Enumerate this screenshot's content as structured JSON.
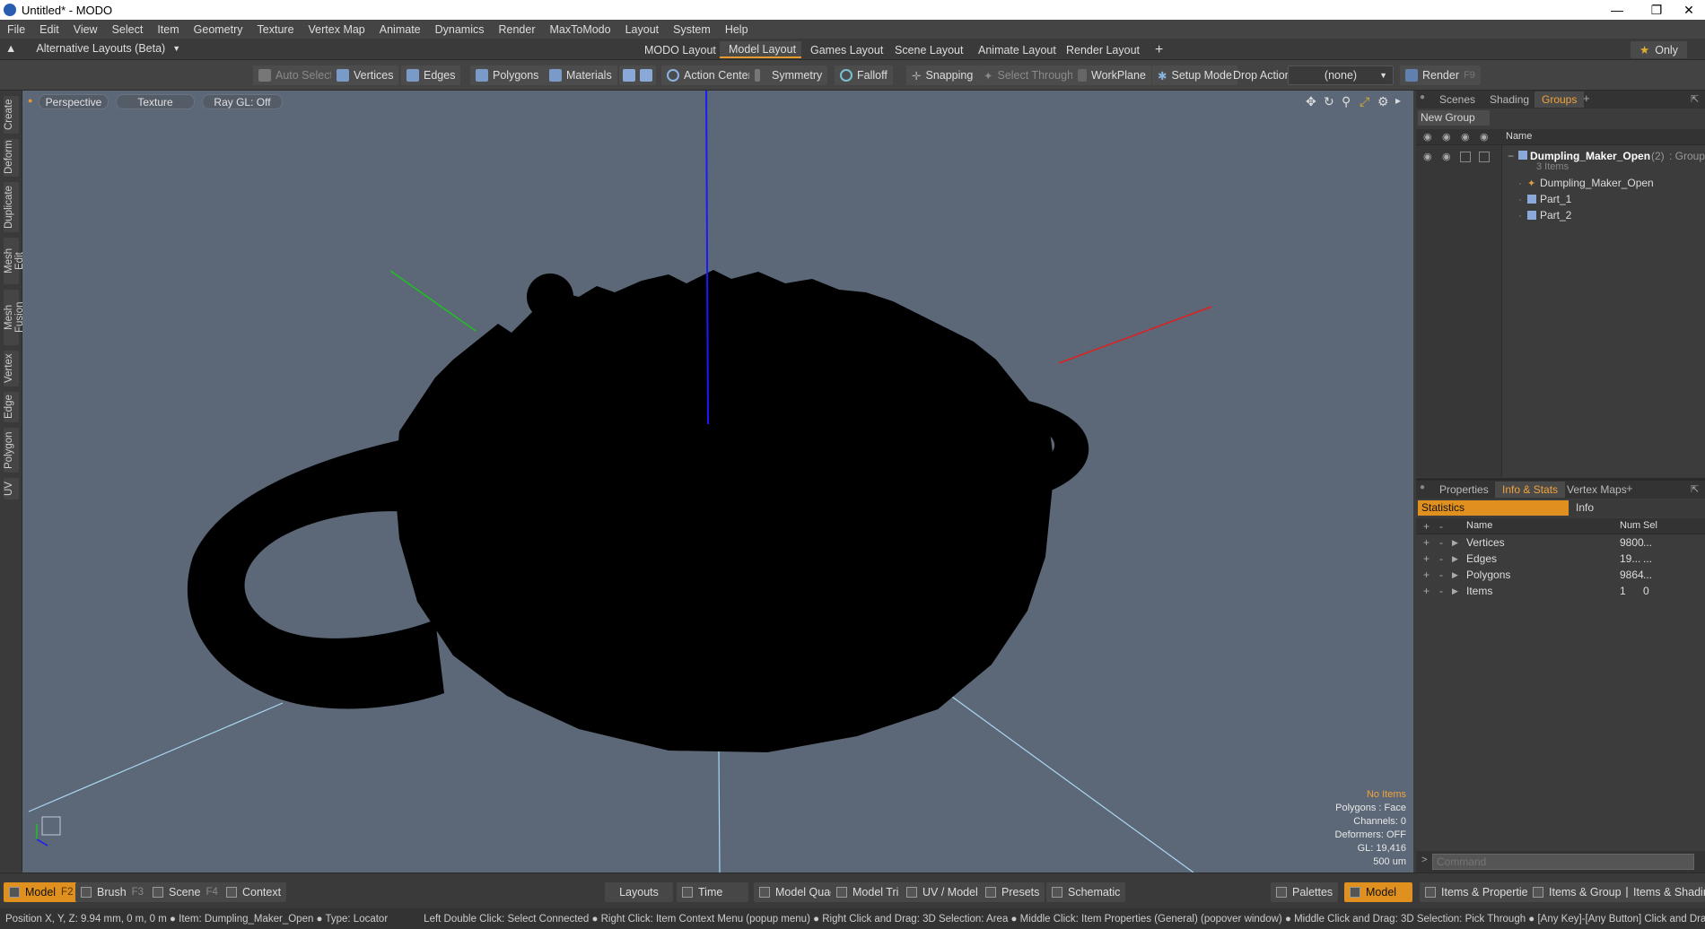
{
  "window": {
    "title": "Untitled* - MODO"
  },
  "menu": [
    "File",
    "Edit",
    "View",
    "Select",
    "Item",
    "Geometry",
    "Texture",
    "Vertex Map",
    "Animate",
    "Dynamics",
    "Render",
    "MaxToModo",
    "Layout",
    "System",
    "Help"
  ],
  "layoutbar": {
    "alt_layouts": "Alternative Layouts (Beta)",
    "tabs": [
      "MODO Layout",
      "Model Layout",
      "Games Layout",
      "Scene Layout",
      "Animate Layout",
      "Render Layout"
    ],
    "active_tab": "Model Layout",
    "only_label": "Only"
  },
  "toolbar": {
    "auto_select": "Auto Select",
    "vertices": "Vertices",
    "edges": "Edges",
    "polygons": "Polygons",
    "materials": "Materials",
    "action_center": "Action Center",
    "symmetry": "Symmetry",
    "falloff": "Falloff",
    "snapping": "Snapping",
    "select_through": "Select Through",
    "workplane": "WorkPlane",
    "setup_mode": "Setup Mode",
    "drop_action_label": "Drop Action",
    "drop_action_value": "(none)",
    "render": "Render",
    "render_key": "F9"
  },
  "lefttabs": [
    "Create",
    "Deform",
    "Duplicate",
    "Mesh Edit",
    "Mesh Fusion",
    "Vertex",
    "Edge",
    "Polygon",
    "UV"
  ],
  "viewport": {
    "view_mode": "Perspective",
    "shading": "Texture",
    "raygl": "Ray GL: Off",
    "hud": {
      "no_items": "No Items",
      "polygons": "Polygons : Face",
      "channels": "Channels: 0",
      "deformers": "Deformers: OFF",
      "gl": "GL: 19,416",
      "scale": "500 um"
    }
  },
  "rightpanel": {
    "top_tabs": [
      "Scenes",
      "Shading",
      "Groups"
    ],
    "active_top_tab": "Groups",
    "new_group": "New Group",
    "name_header": "Name",
    "group": {
      "name": "Dumpling_Maker_Open",
      "count": "(2)",
      "type": ": Group",
      "subtitle": "3 Items"
    },
    "children": [
      "Dumpling_Maker_Open",
      "Part_1",
      "Part_2"
    ],
    "bottom_tabs": [
      "Properties",
      "Info & Stats",
      "Vertex Maps"
    ],
    "active_bottom_tab": "Info & Stats",
    "stats_tabs": [
      "Statistics",
      "Info"
    ],
    "stats_headers": {
      "name": "Name",
      "num": "Num",
      "sel": "Sel"
    },
    "stats": [
      {
        "name": "Vertices",
        "num": "9800",
        "sel": "..."
      },
      {
        "name": "Edges",
        "num": "19...",
        "sel": "..."
      },
      {
        "name": "Polygons",
        "num": "9864",
        "sel": "..."
      },
      {
        "name": "Items",
        "num": "1",
        "sel": "0"
      }
    ],
    "command_placeholder": "Command"
  },
  "bottombar": {
    "model": "Model",
    "model_key": "F2",
    "brush": "Brush",
    "brush_key": "F3",
    "scene": "Scene",
    "scene_key": "F4",
    "context": "Context",
    "layouts": "Layouts",
    "time": "Time",
    "model_quad": "Model Quad",
    "model_tri": "Model Tri",
    "uv_model": "UV / Model",
    "presets": "Presets",
    "schematic": "Schematic",
    "palettes": "Palettes",
    "model_right": "Model",
    "items_properties": "Items & Properties",
    "items_groups": "Items & Groups",
    "items_shading": "Items & Shadin"
  },
  "statusbar": {
    "text": "Position X, Y, Z:   9.94 mm, 0 m, 0 m ●  Item:  Dumpling_Maker_Open ●  Type:  Locator",
    "hints": "Left Double Click: Select Connected ● Right Click: Item Context Menu (popup menu) ● Right Click and Drag: 3D Selection: Area ● Middle Click: Item Properties (General) (popover window) ● Middle Click and Drag: 3D Selection: Pick Through ● [Any Key]-[Any Button] Click and Drag: dragDrop"
  },
  "colors": {
    "accent": "#e79a2b",
    "viewport_bg": "#5c6878",
    "x_axis": "#e02020",
    "y_axis": "#20c020",
    "z_axis": "#1a1aff"
  }
}
